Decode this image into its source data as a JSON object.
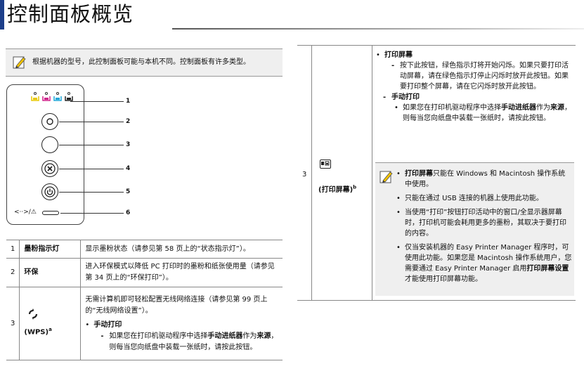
{
  "header": {
    "title": "控制面板概览"
  },
  "note_top": {
    "text": "根据机器的型号，此控制面板可能与本机不同。控制面板有许多类型。"
  },
  "panel": {
    "callouts": [
      "1",
      "2",
      "3",
      "4",
      "5",
      "6"
    ],
    "bottom_label": "<··>/⚠"
  },
  "left_table": {
    "rows": [
      {
        "num": "1",
        "name": "墨粉指示灯",
        "desc": "显示墨粉状态（请参见第 58 页上的“状态指示灯”）。"
      },
      {
        "num": "2",
        "name": "环保",
        "desc": "进入环保模式以降低 PC 打印时的墨粉和纸张使用量（请参见第 34 页上的“环保打印”）。"
      },
      {
        "num": "3",
        "name": "(WPS)",
        "name_sup": "a",
        "desc": "无需计算机即可轻松配置无线网络连接（请参见第 99 页上的“无线网络设置”）。",
        "sub_title": "手动打印",
        "sub_pre": "如果您在打印机驱动程序中选择",
        "sub_bold1": "手动进纸器",
        "sub_mid": "作为",
        "sub_bold2": "来源",
        "sub_post": "，则每当您向纸盘中装载一张纸时，请按此按钮。"
      }
    ]
  },
  "right_table": {
    "num": "3",
    "label": "(打印屏幕)",
    "label_sup": "b",
    "item1_title": "打印屏幕",
    "item1_text": "按下此按钮，绿色指示灯将开始闪烁。如果只要打印活动屏幕，请在绿色指示灯停止闪烁时放开此按钮。如果要打印整个屏幕，请在它闪烁时放开此按钮。",
    "item2_title": "手动打印",
    "item2_pre": "如果您在打印机驱动程序中选择",
    "item2_bold1": "手动进纸器",
    "item2_mid": "作为",
    "item2_bold2": "来源",
    "item2_post": "，则每当您向纸盘中装载一张纸时，请按此按钮。",
    "notes": {
      "n1_bold": "打印屏幕",
      "n1_text": "只能在 Windows 和 Macintosh 操作系统中使用。",
      "n2": "只能在通过 USB 连接的机器上使用此功能。",
      "n3": "当使用“打印”按钮打印活动中的窗口/全显示器屏幕时，打印机可能会耗用更多的墨粉，其取决于要打印的内容。",
      "n4_pre": "仅当安装机器的 Easy Printer Manager 程序时，可使用此功能。如果您是 Macintosh 操作系统用户，您需要通过 Easy Printer Manager 启用",
      "n4_bold": "打印屏幕设置",
      "n4_post": "才能使用打印屏幕功能。"
    }
  },
  "colors": {
    "accent_bar": "#1d3f8a",
    "note_bg": "#efefef",
    "yellow": "#e8c800",
    "magenta": "#d0208a",
    "cyan": "#1fa7d8",
    "black": "#222222"
  }
}
